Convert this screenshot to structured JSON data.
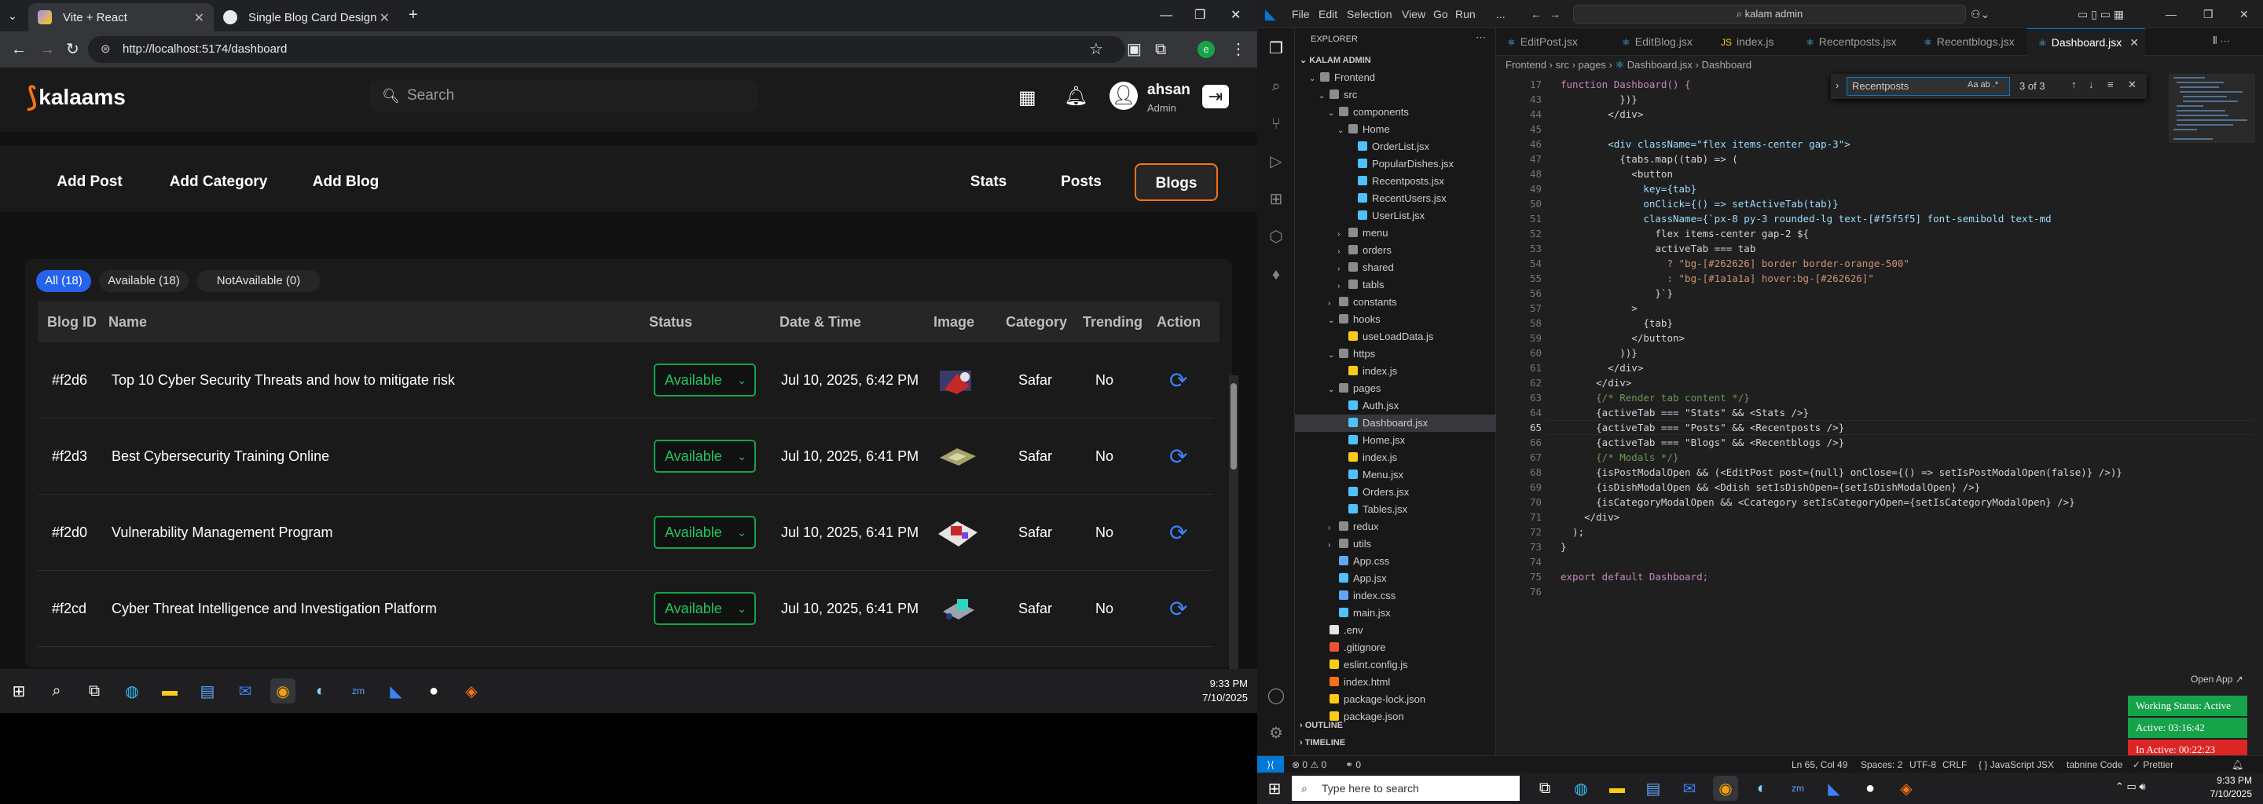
{
  "browser": {
    "tabs": [
      {
        "title": "Vite + React",
        "active": true
      },
      {
        "title": "Single Blog Card Design",
        "active": false
      }
    ],
    "new_tab": "+",
    "url": "http://localhost:5174/dashboard"
  },
  "app": {
    "logo": "kalaams",
    "search_placeholder": "Search",
    "user_name": "ahsan",
    "user_role": "Admin",
    "actions": [
      "Add Post",
      "Add Category",
      "Add Blog"
    ],
    "views": [
      "Stats",
      "Posts",
      "Blogs"
    ],
    "active_view": "Blogs",
    "filters": [
      "All (18)",
      "Available (18)",
      "NotAvailable (0)"
    ],
    "active_filter": "All (18)",
    "columns": [
      "Blog ID",
      "Name",
      "Status",
      "Date & Time",
      "Image",
      "Category",
      "Trending",
      "Action"
    ],
    "rows": [
      {
        "id": "#f2d6",
        "name": "Top 10 Cyber Security Threats and how to mitigate risk",
        "status": "Available",
        "date": "Jul 10, 2025, 6:42 PM",
        "category": "Safar",
        "trending": "No"
      },
      {
        "id": "#f2d3",
        "name": "Best Cybersecurity Training Online",
        "status": "Available",
        "date": "Jul 10, 2025, 6:41 PM",
        "category": "Safar",
        "trending": "No"
      },
      {
        "id": "#f2d0",
        "name": "Vulnerability Management Program",
        "status": "Available",
        "date": "Jul 10, 2025, 6:41 PM",
        "category": "Safar",
        "trending": "No"
      },
      {
        "id": "#f2cd",
        "name": "Cyber Threat Intelligence and Investigation Platform",
        "status": "Available",
        "date": "Jul 10, 2025, 6:41 PM",
        "category": "Safar",
        "trending": "No"
      }
    ]
  },
  "left_taskbar": {
    "time": "9:33 PM",
    "date": "7/10/2025"
  },
  "vscode": {
    "menu": [
      "File",
      "Edit",
      "Selection",
      "View",
      "Go",
      "Run",
      "..."
    ],
    "command_center": "kalam admin",
    "explorer_title": "EXPLORER",
    "root": "KALAM ADMIN",
    "tree": [
      {
        "label": "Frontend",
        "type": "folder",
        "depth": 1,
        "open": true
      },
      {
        "label": "src",
        "type": "folder",
        "depth": 2,
        "open": true
      },
      {
        "label": "components",
        "type": "folder",
        "depth": 3,
        "open": true
      },
      {
        "label": "Home",
        "type": "folder",
        "depth": 4,
        "open": true
      },
      {
        "label": "OrderList.jsx",
        "type": "jsx",
        "depth": 5
      },
      {
        "label": "PopularDishes.jsx",
        "type": "jsx",
        "depth": 5
      },
      {
        "label": "Recentposts.jsx",
        "type": "jsx",
        "depth": 5
      },
      {
        "label": "RecentUsers.jsx",
        "type": "jsx",
        "depth": 5
      },
      {
        "label": "UserList.jsx",
        "type": "jsx",
        "depth": 5
      },
      {
        "label": "menu",
        "type": "folder",
        "depth": 4
      },
      {
        "label": "orders",
        "type": "folder",
        "depth": 4
      },
      {
        "label": "shared",
        "type": "folder",
        "depth": 4
      },
      {
        "label": "tabls",
        "type": "folder",
        "depth": 4
      },
      {
        "label": "constants",
        "type": "folder",
        "depth": 3
      },
      {
        "label": "hooks",
        "type": "folder",
        "depth": 3,
        "open": true
      },
      {
        "label": "useLoadData.js",
        "type": "js",
        "depth": 4
      },
      {
        "label": "https",
        "type": "folder",
        "depth": 3,
        "open": true
      },
      {
        "label": "index.js",
        "type": "js",
        "depth": 4
      },
      {
        "label": "pages",
        "type": "folder",
        "depth": 3,
        "open": true
      },
      {
        "label": "Auth.jsx",
        "type": "jsx",
        "depth": 4
      },
      {
        "label": "Dashboard.jsx",
        "type": "jsx",
        "depth": 4,
        "selected": true
      },
      {
        "label": "Home.jsx",
        "type": "jsx",
        "depth": 4
      },
      {
        "label": "index.js",
        "type": "js",
        "depth": 4
      },
      {
        "label": "Menu.jsx",
        "type": "jsx",
        "depth": 4
      },
      {
        "label": "Orders.jsx",
        "type": "jsx",
        "depth": 4
      },
      {
        "label": "Tables.jsx",
        "type": "jsx",
        "depth": 4
      },
      {
        "label": "redux",
        "type": "folder",
        "depth": 3
      },
      {
        "label": "utils",
        "type": "folder",
        "depth": 3
      },
      {
        "label": "App.css",
        "type": "css",
        "depth": 3
      },
      {
        "label": "App.jsx",
        "type": "jsx",
        "depth": 3
      },
      {
        "label": "index.css",
        "type": "css",
        "depth": 3
      },
      {
        "label": "main.jsx",
        "type": "jsx",
        "depth": 3
      },
      {
        "label": ".env",
        "type": "env",
        "depth": 2
      },
      {
        "label": ".gitignore",
        "type": "git",
        "depth": 2
      },
      {
        "label": "eslint.config.js",
        "type": "js",
        "depth": 2
      },
      {
        "label": "index.html",
        "type": "html",
        "depth": 2
      },
      {
        "label": "package-lock.json",
        "type": "json",
        "depth": 2
      },
      {
        "label": "package.json",
        "type": "json",
        "depth": 2
      }
    ],
    "outline": "OUTLINE",
    "timeline": "TIMELINE",
    "editor_tabs": [
      "EditPost.jsx",
      "EditBlog.jsx",
      "index.js",
      "Recentposts.jsx",
      "Recentblogs.jsx",
      "Dashboard.jsx"
    ],
    "active_tab": "Dashboard.jsx",
    "breadcrumbs": [
      "Frontend",
      "src",
      "pages",
      "Dashboard.jsx",
      "Dashboard"
    ],
    "find_query": "Recentposts",
    "find_result": "3 of 3",
    "find_options": [
      "Aa",
      "ab",
      ".*"
    ],
    "lines": [
      {
        "n": "17",
        "t": "function Dashboard() {"
      },
      {
        "n": "43",
        "t": "          })}"
      },
      {
        "n": "44",
        "t": "        </div>"
      },
      {
        "n": "45",
        "t": ""
      },
      {
        "n": "46",
        "t": "        <div className=\"flex items-center gap-3\">"
      },
      {
        "n": "47",
        "t": "          {tabs.map((tab) => ("
      },
      {
        "n": "48",
        "t": "            <button"
      },
      {
        "n": "49",
        "t": "              key={tab}"
      },
      {
        "n": "50",
        "t": "              onClick={() => setActiveTab(tab)}"
      },
      {
        "n": "51",
        "t": "              className={`px-8 py-3 rounded-lg text-[#f5f5f5] font-semibold text-md"
      },
      {
        "n": "52",
        "t": "                flex items-center gap-2 ${"
      },
      {
        "n": "53",
        "t": "                activeTab === tab"
      },
      {
        "n": "54",
        "t": "                  ? \"bg-[#262626] border border-orange-500\""
      },
      {
        "n": "55",
        "t": "                  : \"bg-[#1a1a1a] hover:bg-[#262626]\""
      },
      {
        "n": "56",
        "t": "                }`}"
      },
      {
        "n": "57",
        "t": "            >"
      },
      {
        "n": "58",
        "t": "              {tab}"
      },
      {
        "n": "59",
        "t": "            </button>"
      },
      {
        "n": "60",
        "t": "          ))}"
      },
      {
        "n": "61",
        "t": "        </div>"
      },
      {
        "n": "62",
        "t": "      </div>"
      },
      {
        "n": "63",
        "t": "      {/* Render tab content */}"
      },
      {
        "n": "64",
        "t": "      {activeTab === \"Stats\" && <Stats />}"
      },
      {
        "n": "65",
        "t": "      {activeTab === \"Posts\" && <Recentposts />}"
      },
      {
        "n": "66",
        "t": "      {activeTab === \"Blogs\" && <Recentblogs />}"
      },
      {
        "n": "67",
        "t": "      {/* Modals */}"
      },
      {
        "n": "68",
        "t": "      {isPostModalOpen && (<EditPost post={null} onClose={() => setIsPostModalOpen(false)} />)}"
      },
      {
        "n": "69",
        "t": "      {isDishModalOpen && <Ddish setIsDishOpen={setIsDishModalOpen} />}"
      },
      {
        "n": "70",
        "t": "      {isCategoryModalOpen && <Ccategory setIsCategoryOpen={setIsCategoryModalOpen} />}"
      },
      {
        "n": "71",
        "t": "    </div>"
      },
      {
        "n": "72",
        "t": "  );"
      },
      {
        "n": "73",
        "t": "}"
      },
      {
        "n": "74",
        "t": ""
      },
      {
        "n": "75",
        "t": "export default Dashboard;"
      },
      {
        "n": "76",
        "t": ""
      }
    ],
    "current_line": "65",
    "open_app": "Open App ↗",
    "badges": [
      {
        "text": "Working Status: Active",
        "color": "#16a34a"
      },
      {
        "text": "Active: 03:16:42",
        "color": "#16a34a"
      },
      {
        "text": "In Active: 00:22:23",
        "color": "#dc2626"
      }
    ],
    "status": {
      "problems": "⊗ 0 ⚠ 0",
      "ports": "⚭ 0",
      "position": "Ln 65, Col 49",
      "spaces": "Spaces: 2",
      "encoding": "UTF-8",
      "eol": "CRLF",
      "language": "{ } JavaScript JSX",
      "tabnine": "tabnine Code",
      "prettier": "✓ Prettier"
    }
  },
  "right_taskbar": {
    "search": "Type here to search",
    "time": "9:33 PM",
    "date": "7/10/2025"
  }
}
